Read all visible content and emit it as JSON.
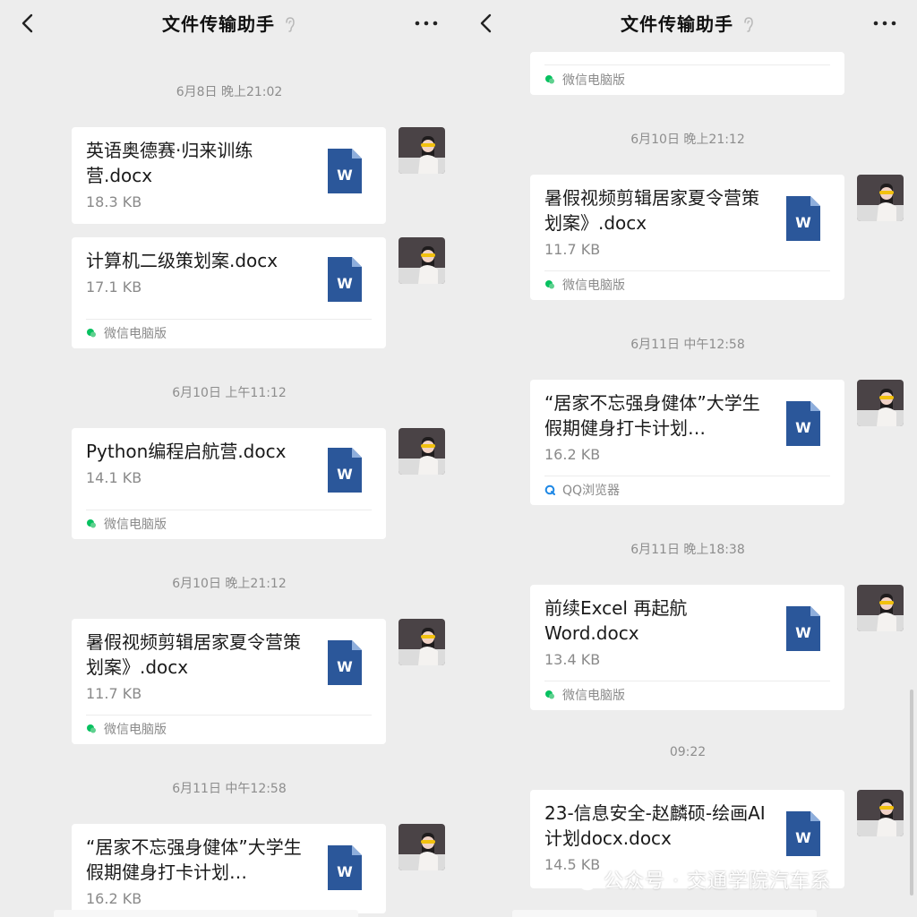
{
  "header": {
    "title": "文件传输助手",
    "icons": [
      "back-icon",
      "mute-icon",
      "more-icon"
    ]
  },
  "left": {
    "items": [
      {
        "type": "time",
        "text": "6月8日 晚上21:02"
      },
      {
        "type": "file",
        "name": "英语奥德赛·归来训练营.docx",
        "size": "18.3 KB",
        "source": ""
      },
      {
        "type": "file",
        "name": "计算机二级策划案.docx",
        "size": "17.1 KB",
        "source": "微信电脑版"
      },
      {
        "type": "time",
        "text": "6月10日 上午11:12"
      },
      {
        "type": "file",
        "name": "Python编程启航营.docx",
        "size": "14.1 KB",
        "source": "微信电脑版"
      },
      {
        "type": "time",
        "text": "6月10日 晚上21:12"
      },
      {
        "type": "file",
        "name": "暑假视频剪辑居家夏令营策划案》.docx",
        "size": "11.7 KB",
        "source": "微信电脑版"
      },
      {
        "type": "time",
        "text": "6月11日 中午12:58"
      },
      {
        "type": "file",
        "name": "“居家不忘强身健体”大学生假期健身打卡计划…",
        "size": "16.2 KB",
        "source": ""
      }
    ]
  },
  "right": {
    "items": [
      {
        "type": "source-tail",
        "source": "微信电脑版"
      },
      {
        "type": "time",
        "text": "6月10日 晚上21:12"
      },
      {
        "type": "file",
        "name": "暑假视频剪辑居家夏令营策划案》.docx",
        "size": "11.7 KB",
        "source": "微信电脑版"
      },
      {
        "type": "time",
        "text": "6月11日 中午12:58"
      },
      {
        "type": "file",
        "name": "“居家不忘强身健体”大学生假期健身打卡计划…",
        "size": "16.2 KB",
        "source": "QQ浏览器"
      },
      {
        "type": "time",
        "text": "6月11日 晚上18:38"
      },
      {
        "type": "file",
        "name": "前续Excel 再起航Word.docx",
        "size": "13.4 KB",
        "source": "微信电脑版"
      },
      {
        "type": "time",
        "text": "09:22"
      },
      {
        "type": "file",
        "name": "23-信息安全-赵麟硕-绘画AI计划docx.docx",
        "size": "14.5 KB",
        "source": ""
      }
    ]
  },
  "watermark": {
    "text": "公众号 · 交通学院汽车系"
  },
  "colors": {
    "background": "#ededed",
    "card": "#ffffff",
    "word_blue": "#2b579a",
    "wechat_green": "#07c160",
    "qq_blue": "#1e88e5",
    "muted_text": "#8a8a8a"
  }
}
